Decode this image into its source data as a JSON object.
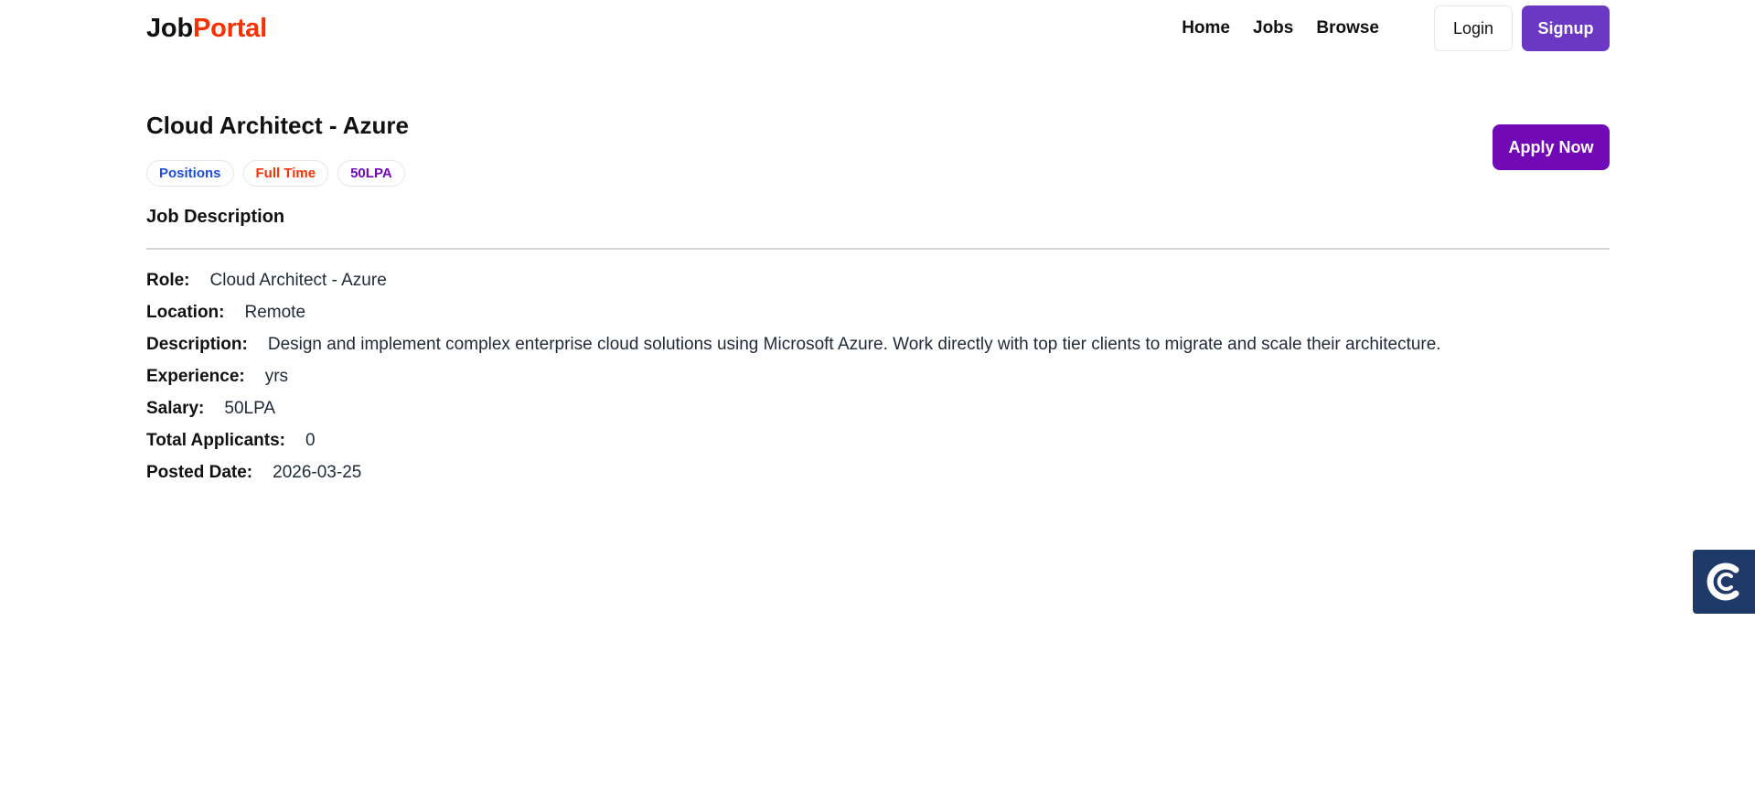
{
  "logo": {
    "part1": "Job",
    "part2": "Portal"
  },
  "nav": {
    "links": [
      "Home",
      "Jobs",
      "Browse"
    ],
    "login_label": "Login",
    "signup_label": "Signup"
  },
  "job": {
    "title": "Cloud Architect - Azure",
    "badges": [
      "Positions",
      "Full Time",
      "50LPA"
    ],
    "apply_label": "Apply Now",
    "section_title": "Job Description",
    "details": [
      {
        "label": "Role:",
        "value": "Cloud Architect - Azure"
      },
      {
        "label": "Location:",
        "value": "Remote"
      },
      {
        "label": "Description:",
        "value": "Design and implement complex enterprise cloud solutions using Microsoft Azure. Work directly with top tier clients to migrate and scale their architecture."
      },
      {
        "label": "Experience:",
        "value": "yrs"
      },
      {
        "label": "Salary:",
        "value": "50LPA"
      },
      {
        "label": "Total Applicants:",
        "value": "0"
      },
      {
        "label": "Posted Date:",
        "value": "2026-03-25"
      }
    ]
  },
  "colors": {
    "brand_red": "#f83002",
    "signup_purple": "#6a38c2",
    "apply_purple": "#7209b7",
    "widget_navy": "#1f3a68"
  },
  "widget": {
    "icon": "chat-c-icon"
  }
}
